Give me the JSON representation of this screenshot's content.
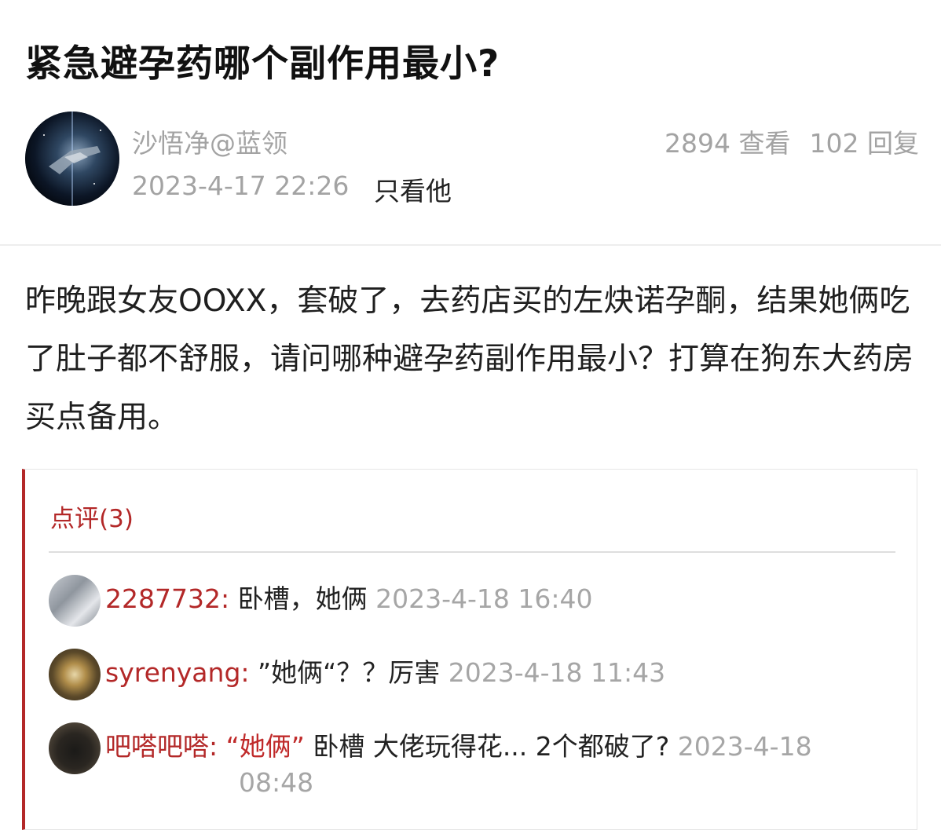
{
  "post": {
    "title": "紧急避孕药哪个副作用最小?",
    "author": "沙悟净@蓝领",
    "date": "2023-4-17 22:26",
    "only_him": "只看他",
    "views": "2894 查看",
    "replies": "102 回复",
    "body": "昨晚跟女友OOXX，套破了，去药店买的左炔诺孕酮，结果她俩吃了肚子都不舒服，请问哪种避孕药副作用最小？打算在狗东大药房买点备用。"
  },
  "comments": {
    "header": "点评(3)",
    "items": [
      {
        "user": "2287732:",
        "quote": "",
        "text": "卧槽，她俩",
        "time": "2023-4-18 16:40"
      },
      {
        "user": "syrenyang:",
        "quote": "",
        "text": "”她俩“？？厉害",
        "time": "2023-4-18 11:43"
      },
      {
        "user": "吧嗒吧嗒:",
        "quote": "“她俩”",
        "text": "卧槽 大佬玩得花... 2个都破了?",
        "time": "2023-4-18",
        "time_line2": "08:48"
      }
    ]
  },
  "colors": {
    "accent": "#b32828",
    "muted": "#a3a3a3"
  }
}
